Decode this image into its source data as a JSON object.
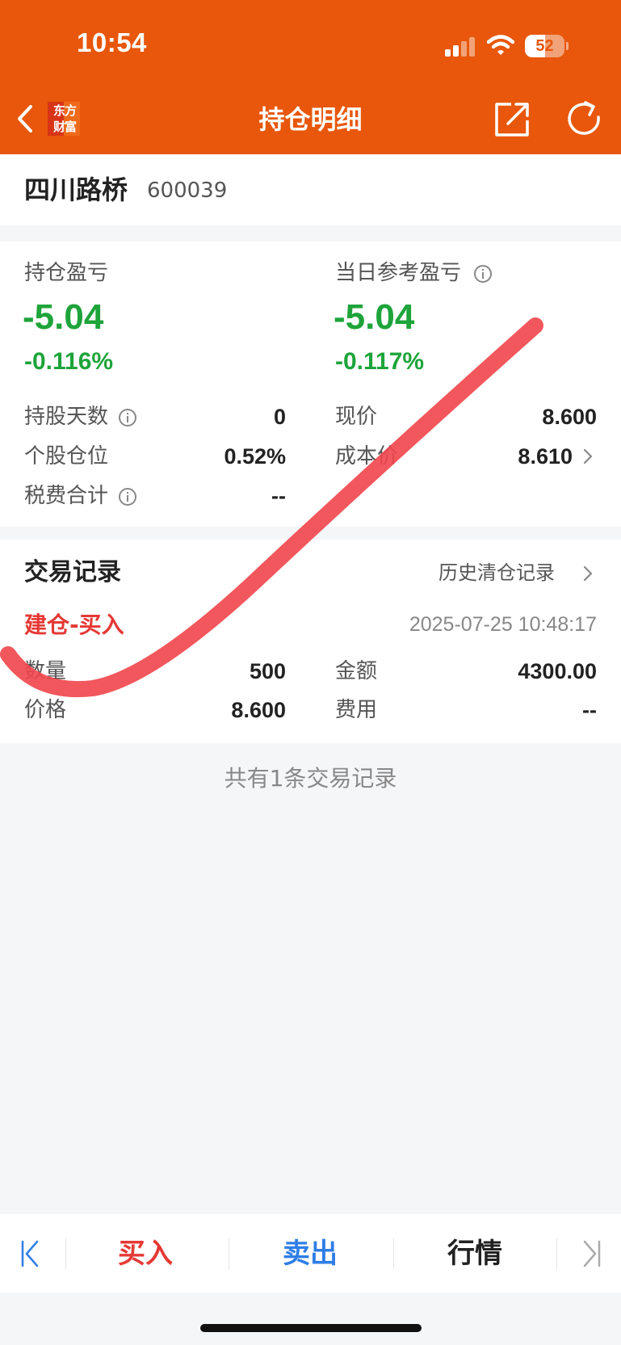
{
  "status_bar": {
    "time": "10:54",
    "battery_level": "52",
    "icons": [
      "cellular-signal-icon",
      "wifi-icon",
      "battery-icon"
    ]
  },
  "header": {
    "logo_text": "东方财富",
    "title": "持仓明细",
    "icons": [
      "back-icon",
      "share-icon",
      "refresh-icon"
    ]
  },
  "stock": {
    "name": "四川路桥",
    "code": "600039"
  },
  "pnl": {
    "position_label": "持仓盈亏",
    "position_value": "-5.04",
    "position_pct": "-0.116%",
    "daily_label": "当日参考盈亏",
    "daily_value": "-5.04",
    "daily_pct": "-0.117%"
  },
  "details": {
    "holding_days_label": "持股天数",
    "holding_days": "0",
    "current_price_label": "现价",
    "current_price": "8.600",
    "position_ratio_label": "个股仓位",
    "position_ratio": "0.52%",
    "cost_price_label": "成本价",
    "cost_price": "8.610",
    "fees_label": "税费合计",
    "fees": "--"
  },
  "trades": {
    "section_title": "交易记录",
    "history_link": "历史清仓记录",
    "records": [
      {
        "type": "建仓-买入",
        "time": "2025-07-25 10:48:17",
        "qty_label": "数量",
        "qty": "500",
        "amount_label": "金额",
        "amount": "4300.00",
        "price_label": "价格",
        "price": "8.600",
        "fee_label": "费用",
        "fee": "--"
      }
    ],
    "summary": "共有1条交易记录"
  },
  "bottom_bar": {
    "buy": "买入",
    "sell": "卖出",
    "quote": "行情"
  },
  "colors": {
    "brand": "#e8570b",
    "loss": "#1ea43a",
    "buy": "#e53935",
    "sell": "#2f7ee6",
    "annotation": "#f0454a"
  }
}
